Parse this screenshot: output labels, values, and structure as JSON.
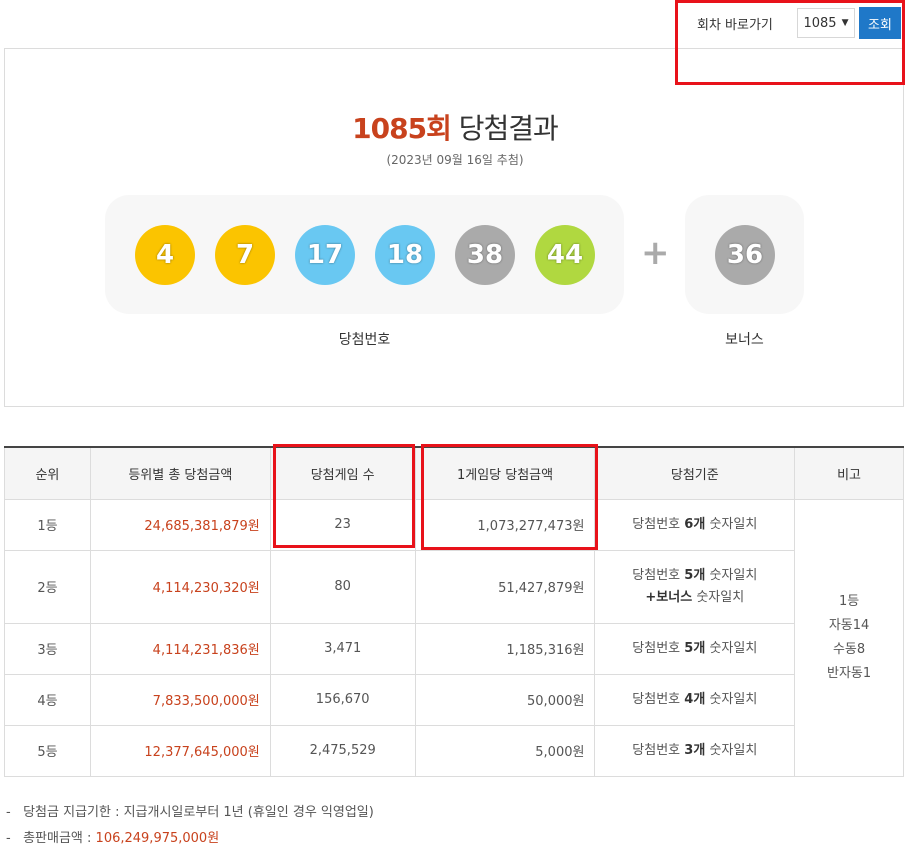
{
  "nav": {
    "label": "회차 바로가기",
    "selected_round": "1085",
    "go_button": "조회"
  },
  "result": {
    "round": "1085회",
    "title_suffix": "당첨결과",
    "draw_date": "(2023년 09월 16일 추첨)",
    "numbers": [
      {
        "value": "4",
        "color": "#fbc400"
      },
      {
        "value": "7",
        "color": "#fbc400"
      },
      {
        "value": "17",
        "color": "#69c8f2"
      },
      {
        "value": "18",
        "color": "#69c8f2"
      },
      {
        "value": "38",
        "color": "#aaaaaa"
      },
      {
        "value": "44",
        "color": "#b0d840"
      }
    ],
    "plus": "+",
    "bonus": {
      "value": "36",
      "color": "#aaaaaa"
    },
    "numbers_label": "당첨번호",
    "bonus_label": "보너스"
  },
  "table": {
    "headers": [
      "순위",
      "등위별 총 당첨금액",
      "당첨게임 수",
      "1게임당 당첨금액",
      "당첨기준",
      "비고"
    ],
    "rows": [
      {
        "rank": "1등",
        "total": "24,685,381,879원",
        "count": "23",
        "per_game": "1,073,277,473원",
        "crit_pre": "당첨번호",
        "crit_bold": "6개",
        "crit_post": "숫자일치",
        "crit_line2_bold": "",
        "crit_line2_post": ""
      },
      {
        "rank": "2등",
        "total": "4,114,230,320원",
        "count": "80",
        "per_game": "51,427,879원",
        "crit_pre": "당첨번호",
        "crit_bold": "5개",
        "crit_post": "숫자일치",
        "crit_line2_bold": "+보너스",
        "crit_line2_post": "숫자일치"
      },
      {
        "rank": "3등",
        "total": "4,114,231,836원",
        "count": "3,471",
        "per_game": "1,185,316원",
        "crit_pre": "당첨번호",
        "crit_bold": "5개",
        "crit_post": "숫자일치",
        "crit_line2_bold": "",
        "crit_line2_post": ""
      },
      {
        "rank": "4등",
        "total": "7,833,500,000원",
        "count": "156,670",
        "per_game": "50,000원",
        "crit_pre": "당첨번호",
        "crit_bold": "4개",
        "crit_post": "숫자일치",
        "crit_line2_bold": "",
        "crit_line2_post": ""
      },
      {
        "rank": "5등",
        "total": "12,377,645,000원",
        "count": "2,475,529",
        "per_game": "5,000원",
        "crit_pre": "당첨번호",
        "crit_bold": "3개",
        "crit_post": "숫자일치",
        "crit_line2_bold": "",
        "crit_line2_post": ""
      }
    ],
    "note_lines": [
      "1등",
      "자동14",
      "수동8",
      "반자동1"
    ]
  },
  "notes": {
    "deadline_label": "당첨금 지급기한 : ",
    "deadline_value": "지급개시일로부터 1년 (휴일인 경우 익영업일)",
    "sales_label": "총판매금액 : ",
    "sales_value": "106,249,975,000원"
  },
  "colors": {
    "accent_red": "#c8421d",
    "button_blue": "#1f78c8",
    "highlight_box": "#e8121a"
  }
}
